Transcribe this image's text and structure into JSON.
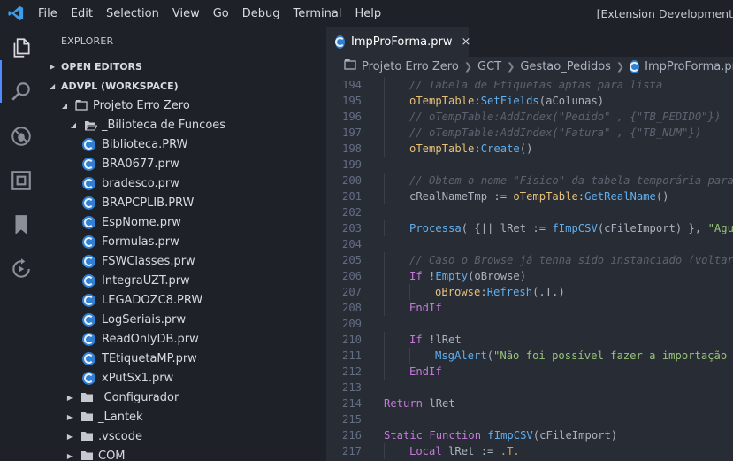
{
  "titlebar": {
    "menu": [
      "File",
      "Edit",
      "Selection",
      "View",
      "Go",
      "Debug",
      "Terminal",
      "Help"
    ],
    "window_title": "[Extension Development"
  },
  "sidebar": {
    "title": "EXPLORER",
    "open_editors": "OPEN EDITORS",
    "workspace": "ADVPL (WORKSPACE)",
    "project": "Projeto Erro Zero",
    "folder_open": "_Bilioteca de Funcoes",
    "files": [
      "Biblioteca.PRW",
      "BRA0677.prw",
      "bradesco.prw",
      "BRAPCPLIB.PRW",
      "EspNome.prw",
      "Formulas.prw",
      "FSWClasses.prw",
      "IntegraUZT.prw",
      "LEGADOZC8.PRW",
      "LogSeriais.prw",
      "ReadOnlyDB.prw",
      "TEtiquetaMP.prw",
      "xPutSx1.prw"
    ],
    "folders": [
      "_Configurador",
      "_Lantek",
      ".vscode",
      "COM"
    ]
  },
  "editor": {
    "tab_label": "ImpProForma.prw",
    "tab_close": "×",
    "breadcrumb": [
      "Projeto Erro Zero",
      "GCT",
      "Gestao_Pedidos",
      "ImpProForma.prw"
    ]
  },
  "code": [
    {
      "n": "194",
      "i": 1,
      "t": [
        [
          "// Tabela de Etiquetas aptas para lista",
          "c"
        ]
      ]
    },
    {
      "n": "195",
      "i": 1,
      "t": [
        [
          "oTempTable",
          "v"
        ],
        [
          ":",
          "p"
        ],
        [
          "SetFields",
          "f"
        ],
        [
          "(aColunas)",
          "p"
        ]
      ]
    },
    {
      "n": "196",
      "i": 1,
      "t": [
        [
          "// oTempTable:AddIndex(\"Pedido\" , {\"TB_PEDIDO\"})",
          "c"
        ]
      ]
    },
    {
      "n": "197",
      "i": 1,
      "t": [
        [
          "// oTempTable:AddIndex(\"Fatura\" , {\"TB_NUM\"})",
          "c"
        ]
      ]
    },
    {
      "n": "198",
      "i": 1,
      "t": [
        [
          "oTempTable",
          "v"
        ],
        [
          ":",
          "p"
        ],
        [
          "Create",
          "f"
        ],
        [
          "()",
          "p"
        ]
      ]
    },
    {
      "n": "199",
      "i": 0,
      "t": []
    },
    {
      "n": "200",
      "i": 1,
      "t": [
        [
          "// Obtem o nome \"Físico\" da tabela temporária para c",
          "c"
        ]
      ]
    },
    {
      "n": "201",
      "i": 1,
      "t": [
        [
          "cRealNameTmp := ",
          "p"
        ],
        [
          "oTempTable",
          "v"
        ],
        [
          ":",
          "p"
        ],
        [
          "GetRealName",
          "f"
        ],
        [
          "()",
          "p"
        ]
      ]
    },
    {
      "n": "202",
      "i": 0,
      "t": []
    },
    {
      "n": "203",
      "i": 1,
      "t": [
        [
          "Processa",
          "f"
        ],
        [
          "( {|| lRet := ",
          "p"
        ],
        [
          "fImpCSV",
          "f"
        ],
        [
          "(cFileImport) }, ",
          "p"
        ],
        [
          "\"Aguar",
          "s"
        ]
      ]
    },
    {
      "n": "204",
      "i": 0,
      "t": []
    },
    {
      "n": "205",
      "i": 1,
      "t": [
        [
          "// Caso o Browse já tenha sido instanciado (voltar d",
          "c"
        ]
      ]
    },
    {
      "n": "206",
      "i": 1,
      "t": [
        [
          "If",
          "k"
        ],
        [
          " !",
          "p"
        ],
        [
          "Empty",
          "f"
        ],
        [
          "(oBrowse)",
          "p"
        ]
      ]
    },
    {
      "n": "207",
      "i": 2,
      "t": [
        [
          "oBrowse",
          "v"
        ],
        [
          ":",
          "p"
        ],
        [
          "Refresh",
          "f"
        ],
        [
          "(.T.)",
          "p"
        ]
      ]
    },
    {
      "n": "208",
      "i": 1,
      "t": [
        [
          "EndIf",
          "k"
        ]
      ]
    },
    {
      "n": "209",
      "i": 0,
      "t": []
    },
    {
      "n": "210",
      "i": 1,
      "t": [
        [
          "If",
          "k"
        ],
        [
          " !lRet",
          "p"
        ]
      ]
    },
    {
      "n": "211",
      "i": 2,
      "t": [
        [
          "MsgAlert",
          "f"
        ],
        [
          "(",
          "p"
        ],
        [
          "\"Não foi possível fazer a importação do",
          "s"
        ]
      ]
    },
    {
      "n": "212",
      "i": 1,
      "t": [
        [
          "EndIf",
          "k"
        ]
      ]
    },
    {
      "n": "213",
      "i": 0,
      "t": []
    },
    {
      "n": "214",
      "i": 0,
      "t": [
        [
          "Return",
          "k"
        ],
        [
          " lRet",
          "p"
        ]
      ]
    },
    {
      "n": "215",
      "i": 0,
      "t": []
    },
    {
      "n": "216",
      "i": 0,
      "t": [
        [
          "Static Function",
          "k"
        ],
        [
          " ",
          "p"
        ],
        [
          "fImpCSV",
          "f"
        ],
        [
          "(cFileImport)",
          "p"
        ]
      ]
    },
    {
      "n": "217",
      "i": 1,
      "t": [
        [
          "Local",
          "k"
        ],
        [
          " lRet := ",
          "p"
        ],
        [
          ".T.",
          "o"
        ]
      ]
    }
  ],
  "colors": {
    "k": "#c678dd",
    "f": "#61afef",
    "v": "#e5c07b",
    "c": "#5c6370",
    "s": "#98c379",
    "p": "#abb2bf",
    "o": "#d19a66"
  }
}
